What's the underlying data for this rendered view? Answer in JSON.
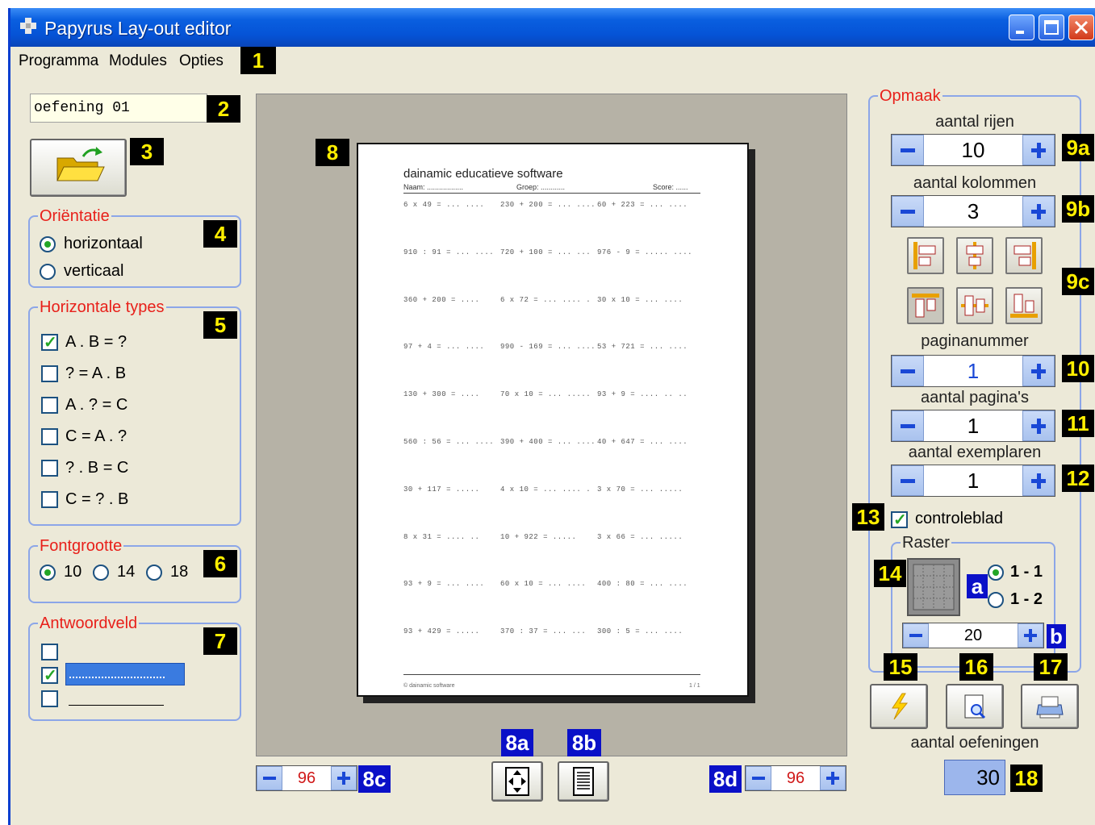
{
  "window": {
    "title": "Papyrus Lay-out editor"
  },
  "menu": {
    "items": [
      "Programma",
      "Modules",
      "Opties"
    ]
  },
  "badges": {
    "b1": "1",
    "b2": "2",
    "b3": "3",
    "b4": "4",
    "b5": "5",
    "b6": "6",
    "b7": "7",
    "b8": "8",
    "b8a": "8a",
    "b8b": "8b",
    "b8c": "8c",
    "b8d": "8d",
    "b9a": "9a",
    "b9b": "9b",
    "b9c": "9c",
    "b10": "10",
    "b11": "11",
    "b12": "12",
    "b13": "13",
    "b14": "14",
    "b15": "15",
    "b16": "16",
    "b17": "17",
    "b18": "18",
    "ba": "a",
    "bb": "b"
  },
  "name_field": {
    "value": "oefening 01"
  },
  "orientation": {
    "title": "Oriëntatie",
    "options": [
      "horizontaal",
      "verticaal"
    ],
    "selected": "horizontaal"
  },
  "horizontal_types": {
    "title": "Horizontale types",
    "items": [
      {
        "label": "A . B = ?",
        "checked": true
      },
      {
        "label": "? = A . B",
        "checked": false
      },
      {
        "label": "A . ? = C",
        "checked": false
      },
      {
        "label": "C = A . ?",
        "checked": false
      },
      {
        "label": "? . B = C",
        "checked": false
      },
      {
        "label": "C = ? . B",
        "checked": false
      }
    ]
  },
  "font_size": {
    "title": "Fontgrootte",
    "options": [
      "10",
      "14",
      "18"
    ],
    "selected": "10"
  },
  "answer_field": {
    "title": "Antwoordveld"
  },
  "document": {
    "title": "dainamic educatieve software",
    "naam": "Naam: ..................",
    "groep": "Groep: ............",
    "score": "Score: ......",
    "footer": "© dainamic software",
    "page": "1 / 1",
    "exercises": [
      [
        "6 x 49 = ... ....",
        "230 + 200 = ... ....",
        "60 + 223 = ... ...."
      ],
      [
        "910 : 91 = ... ....",
        "720 + 100 = ... ...",
        "976 - 9 = ..... ...."
      ],
      [
        "360 + 200 = ....",
        "6 x 72 = ... .... .",
        "30 x 10 = ... ...."
      ],
      [
        "97 + 4 = ... ....",
        "990 - 169 = ... ....",
        "53 + 721 = ... ...."
      ],
      [
        "130 + 300 = ....",
        "70 x 10 = ... .....",
        "93 + 9 = .... .. .."
      ],
      [
        "560 : 56 = ... ....",
        "390 + 400 = ... ....",
        "40 + 647 = ... ...."
      ],
      [
        "30 + 117 = .....",
        "4 x 10 = ... .... .",
        "3 x 70 = ... ....."
      ],
      [
        "8 x 31 = .... ..",
        "10 + 922 = .....",
        "3 x 66 = ... ....."
      ],
      [
        "93 + 9 = ... ....",
        "60 x 10 = ... ....",
        "400 : 80 = ... ...."
      ],
      [
        "93 + 429 = .....",
        "370 : 37 = ... ...",
        "300 : 5 = ... ...."
      ]
    ]
  },
  "zoom_left": {
    "value": "96"
  },
  "zoom_right": {
    "value": "96"
  },
  "opmaak": {
    "title": "Opmaak",
    "rows": {
      "label": "aantal rijen",
      "value": "10"
    },
    "cols": {
      "label": "aantal kolommen",
      "value": "3"
    },
    "page_number": {
      "label": "paginanummer",
      "value": "1"
    },
    "page_count": {
      "label": "aantal pagina's",
      "value": "1"
    },
    "copies": {
      "label": "aantal exemplaren",
      "value": "1"
    },
    "controleblad": {
      "label": "controleblad",
      "checked": true
    }
  },
  "raster": {
    "title": "Raster",
    "options": [
      "1 - 1",
      "1 - 2"
    ],
    "selected": "1 - 1",
    "value": "20"
  },
  "exercise_count": {
    "label": "aantal oefeningen",
    "value": "30"
  },
  "colors": {
    "title_bar": "#0553d6",
    "group_title": "#e8201a",
    "badge_bg": "#000000",
    "badge_fg": "#ffef00",
    "badge_blue": "#0a10c8"
  }
}
